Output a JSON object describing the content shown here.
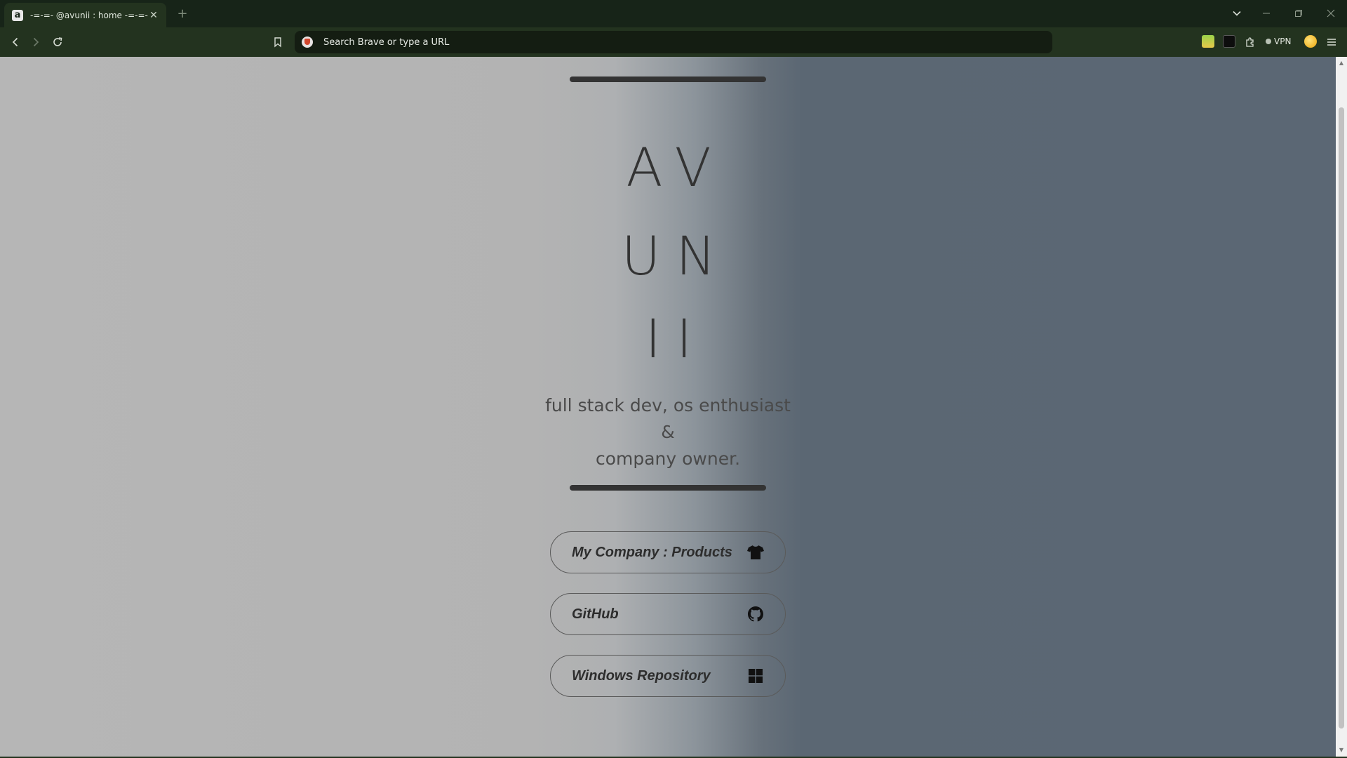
{
  "browser": {
    "tab": {
      "title": "-=-=- @avunii : home -=-=-",
      "favicon_glyph": "a",
      "close_glyph": "✕"
    },
    "new_tab_glyph": "+",
    "window_controls": {
      "tab_search_glyph": "⌄",
      "minimize_glyph": "—",
      "restore_glyph": "❐",
      "close_glyph": "✕"
    },
    "toolbar": {
      "address_placeholder": "Search Brave or type a URL",
      "vpn_label": "VPN",
      "icons": [
        "back-icon",
        "forward-icon",
        "reload-icon",
        "bookmark-icon",
        "brave-shield-icon",
        "extension-1-icon",
        "extension-2-icon",
        "extensions-puzzle-icon",
        "rewards-icon",
        "menu-icon"
      ]
    }
  },
  "page": {
    "logo_rows": [
      "AV",
      "UN",
      "II"
    ],
    "tagline_lines": [
      "full stack dev, os enthusiast &",
      "company owner."
    ],
    "links": [
      {
        "label": "My Company : Products",
        "icon": "tshirt-icon"
      },
      {
        "label": "GitHub",
        "icon": "github-icon"
      },
      {
        "label": "Windows Repository",
        "icon": "windows-icon"
      }
    ]
  },
  "colors": {
    "tab_strip": "#172418",
    "toolbar": "#23331f",
    "page_left": "#b4b4b4",
    "page_right": "#5b6774",
    "text_dark": "#333333"
  }
}
